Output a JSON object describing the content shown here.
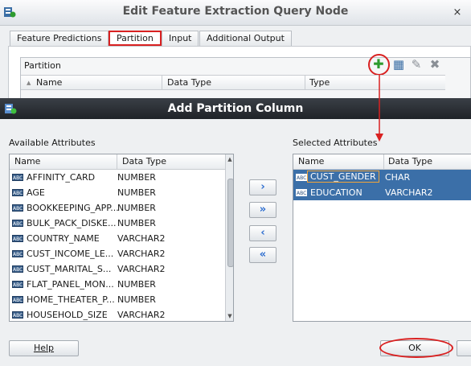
{
  "parent": {
    "title": "Edit Feature Extraction Query Node",
    "close_glyph": "×",
    "tabs": [
      {
        "label": "Feature Predictions",
        "active": false
      },
      {
        "label": "Partition",
        "active": true
      },
      {
        "label": "Input",
        "active": false
      },
      {
        "label": "Additional Output",
        "active": false
      }
    ],
    "partition": {
      "label": "Partition",
      "columns": [
        "Name",
        "Data Type",
        "Type"
      ],
      "toolbar": [
        {
          "name": "add-icon",
          "glyph": "✚",
          "color": "#2e9b2e"
        },
        {
          "name": "edit-grid-icon",
          "glyph": "▦",
          "color": "#3a6ea5"
        },
        {
          "name": "pencil-icon",
          "glyph": "✎",
          "color": "#8a8f96"
        },
        {
          "name": "delete-icon",
          "glyph": "✖",
          "color": "#8a8f96"
        }
      ]
    }
  },
  "dialog": {
    "title": "Add Partition Column",
    "available": {
      "label": "Available Attributes",
      "columns": [
        "Name",
        "Data Type"
      ],
      "rows": [
        {
          "name": "AFFINITY_CARD",
          "type": "NUMBER"
        },
        {
          "name": "AGE",
          "type": "NUMBER"
        },
        {
          "name": "BOOKKEEPING_APP...",
          "type": "NUMBER"
        },
        {
          "name": "BULK_PACK_DISKE...",
          "type": "NUMBER"
        },
        {
          "name": "COUNTRY_NAME",
          "type": "VARCHAR2"
        },
        {
          "name": "CUST_INCOME_LE...",
          "type": "VARCHAR2"
        },
        {
          "name": "CUST_MARITAL_S...",
          "type": "VARCHAR2"
        },
        {
          "name": "FLAT_PANEL_MON...",
          "type": "NUMBER"
        },
        {
          "name": "HOME_THEATER_P...",
          "type": "NUMBER"
        },
        {
          "name": "HOUSEHOLD_SIZE",
          "type": "VARCHAR2"
        }
      ]
    },
    "selected": {
      "label": "Selected Attributes",
      "columns": [
        "Name",
        "Data Type"
      ],
      "rows": [
        {
          "name": "CUST_GENDER",
          "type": "CHAR"
        },
        {
          "name": "EDUCATION",
          "type": "VARCHAR2"
        }
      ]
    },
    "move_buttons": [
      {
        "name": "move-right-button",
        "glyph": "›"
      },
      {
        "name": "move-all-right-button",
        "glyph": "»"
      },
      {
        "name": "move-left-button",
        "glyph": "‹"
      },
      {
        "name": "move-all-left-button",
        "glyph": "«"
      }
    ],
    "row_icon_text": "ABC",
    "help_label": "Help",
    "ok_label": "OK"
  },
  "colors": {
    "highlight": "#d92121",
    "selection": "#3b6fa8",
    "move_arrow": "#2f6fd0"
  }
}
